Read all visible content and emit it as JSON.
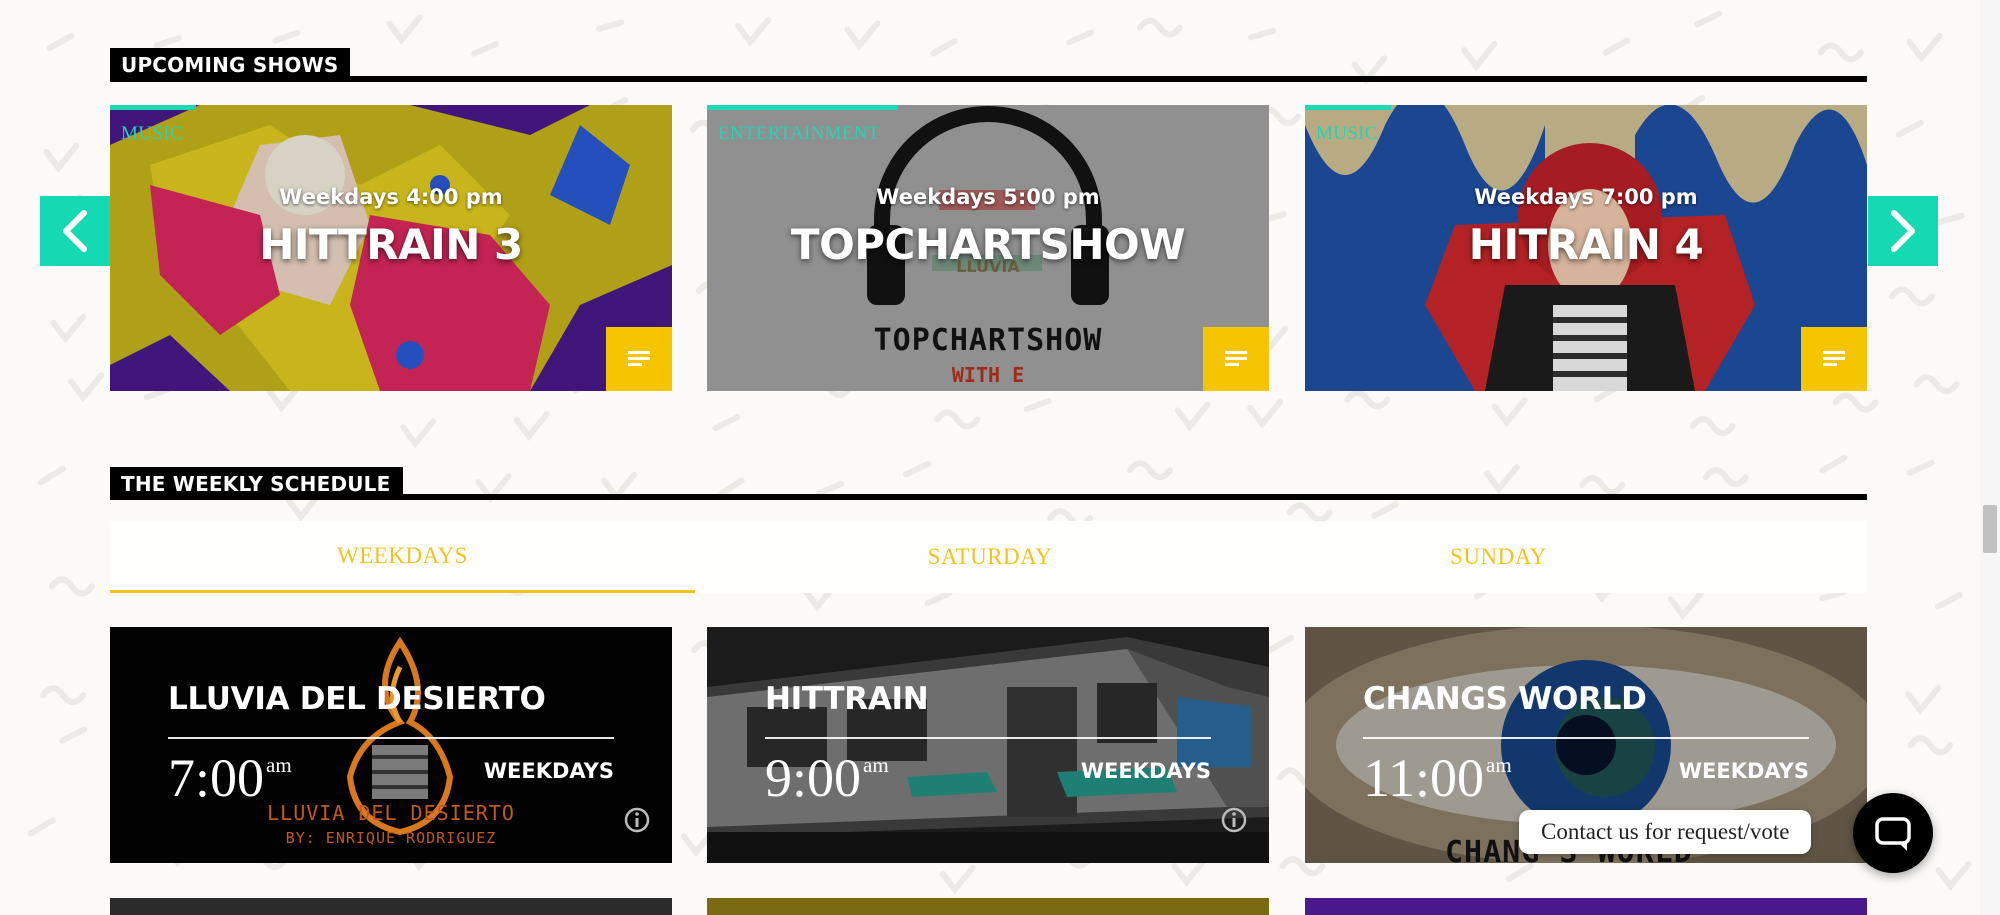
{
  "upcoming": {
    "heading": "UPCOMING SHOWS",
    "prev_icon": "chevron-left-icon",
    "next_icon": "chevron-right-icon",
    "accent_color": "#1fd6b5",
    "button_color": "#f4c500",
    "shows": [
      {
        "category": "MUSIC",
        "time": "Weekdays 4:00 pm",
        "title": "HITTRAIN 3"
      },
      {
        "category": "ENTERTAINMENT",
        "time": "Weekdays 5:00 pm",
        "title": "TOPCHARTSHOW",
        "art_text_1": "TOPCHARTSHOW",
        "art_text_2": "WITH E",
        "logo_text": "LLUVIA"
      },
      {
        "category": "MUSIC",
        "time": "Weekdays 7:00 pm",
        "title": "HITRAIN 4"
      }
    ]
  },
  "schedule": {
    "heading": "THE WEEKLY SCHEDULE",
    "tab_color": "#f2c31d",
    "tabs": [
      {
        "label": "WEEKDAYS",
        "active": true
      },
      {
        "label": "SATURDAY",
        "active": false
      },
      {
        "label": "SUNDAY",
        "active": false
      }
    ],
    "items": [
      {
        "title": "LLUVIA DEL DESIERTO",
        "time": "7:00",
        "meridiem": "am",
        "days": "WEEKDAYS",
        "art_text_1": "LLUVIA DEL DESIERTO",
        "art_text_2": "BY: ENRIQUE RODRIGUEZ"
      },
      {
        "title": "HITTRAIN",
        "time": "9:00",
        "meridiem": "am",
        "days": "WEEKDAYS"
      },
      {
        "title": "CHANGS WORLD",
        "time": "11:00",
        "meridiem": "am",
        "days": "WEEKDAYS",
        "art_text_1": "CHANG'S WORLD"
      }
    ]
  },
  "contact": {
    "label": "Contact us for request/vote",
    "icon": "chat-icon"
  }
}
